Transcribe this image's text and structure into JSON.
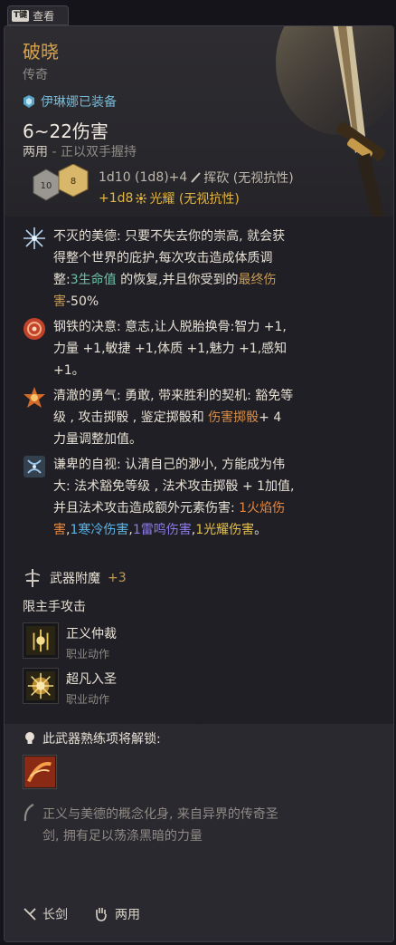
{
  "hint": {
    "key": "T键",
    "label": "查看"
  },
  "item": {
    "name": "破晓",
    "rarity": "传奇",
    "equipped": "伊琳娜已装备",
    "damage": "6~22伤害",
    "handedness": "两用",
    "handedness_note": " - 正以双手握持"
  },
  "damage_rolls": {
    "dice_labels": [
      "10",
      "8"
    ],
    "line1_dice": "1d10 (1d8)+4",
    "line1_type": "挥砍 (无视抗性)",
    "line2_dice": "+1d8",
    "line2_type": "光耀 (无视抗性)"
  },
  "traits": [
    {
      "icon": "star-burst-icon",
      "parts": [
        {
          "t": "不灭的美德: 只要不失去你的崇高, 就会获得整个世界的庇护,每次攻击造成体质调整:"
        },
        {
          "t": "3生命值",
          "c": "hl-green"
        },
        {
          "t": " 的恢复,并且你受到的"
        },
        {
          "t": "最终伤害",
          "c": "hl-gold"
        },
        {
          "t": "-50%"
        }
      ]
    },
    {
      "icon": "resolve-icon",
      "parts": [
        {
          "t": "钢铁的决意: 意志,让人脱胎换骨:智力 +1,力量 +1,敏捷 +1,体质 +1,魅力 +1,感知 +1。"
        }
      ]
    },
    {
      "icon": "courage-icon",
      "parts": [
        {
          "t": "清澈的勇气: 勇敢, 带来胜利的契机: 豁免等级 , 攻击掷骰 , 鉴定掷骰和 "
        },
        {
          "t": "伤害掷骰",
          "c": "hl-orange"
        },
        {
          "t": "+ 4 力量调整加值。"
        }
      ]
    },
    {
      "icon": "humility-icon",
      "parts": [
        {
          "t": "谦卑的自视: 认清自己的渺小, 方能成为伟大: 法术豁免等级 , 法术攻击掷骰 + 1加值, 并且法术攻击造成额外元素伤害: "
        },
        {
          "t": "1火焰伤害",
          "c": "hl-fire"
        },
        {
          "t": ","
        },
        {
          "t": "1寒冷伤害",
          "c": "hl-cold"
        },
        {
          "t": ","
        },
        {
          "t": "1雷鸣伤害",
          "c": "hl-thunder"
        },
        {
          "t": ","
        },
        {
          "t": "1光耀伤害",
          "c": "hl-radiant"
        },
        {
          "t": "。"
        }
      ]
    }
  ],
  "enchant": {
    "label": "武器附魔",
    "value": "+3"
  },
  "mainhand_label": "限主手攻击",
  "actions": [
    {
      "name": "正义仲裁",
      "type": "职业动作"
    },
    {
      "name": "超凡入圣",
      "type": "职业动作"
    }
  ],
  "mastery_label": "此武器熟练项将解锁:",
  "lore": "正义与美德的概念化身, 来自异界的传奇圣剑, 拥有足以荡涤黑暗的力量",
  "footer": {
    "weapon_type": "长剑",
    "handedness": "两用"
  },
  "colors": {
    "title": "#d6a450",
    "equipped": "#76b9d6",
    "radiant": "#e2b542"
  }
}
